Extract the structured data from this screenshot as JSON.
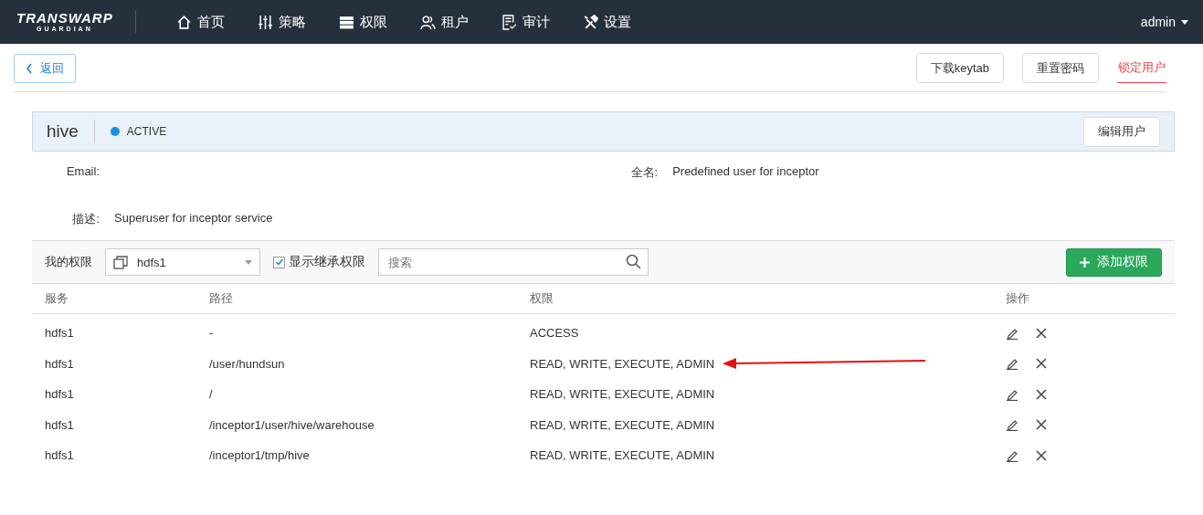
{
  "header": {
    "logo": {
      "title": "TRANSWARP",
      "subtitle": "GUARDIAN"
    },
    "nav": [
      {
        "label": "首页"
      },
      {
        "label": "策略"
      },
      {
        "label": "权限"
      },
      {
        "label": "租户"
      },
      {
        "label": "审计"
      },
      {
        "label": "设置"
      }
    ],
    "user_menu": "admin"
  },
  "toolbar": {
    "back": "返回",
    "actions": [
      {
        "label": "下载keytab",
        "kind": "button"
      },
      {
        "label": "重置密码",
        "kind": "button"
      },
      {
        "label": "锁定用户",
        "kind": "danger"
      }
    ]
  },
  "user": {
    "name": "hive",
    "status": "ACTIVE",
    "edit": "编辑用户",
    "fields": [
      {
        "label": "Email:"
      },
      {
        "label": "全名:",
        "value": "Predefined user for inceptor"
      },
      {
        "label": "描述:",
        "value": "Superuser for inceptor service"
      }
    ]
  },
  "filter": {
    "label": "我的权限",
    "service": "hdfs1",
    "inherit": {
      "label": "显示继承权限",
      "checked": true
    },
    "search": {
      "placeholder": "搜索"
    },
    "add": "添加权限"
  },
  "table": {
    "columns": [
      "服务",
      "路径",
      "权限",
      "操作"
    ],
    "rows": [
      {
        "service": "hdfs1",
        "path": "-",
        "permission": "ACCESS",
        "marked": false
      },
      {
        "service": "hdfs1",
        "path": "/user/hundsun",
        "permission": "READ, WRITE, EXECUTE, ADMIN",
        "marked": true
      },
      {
        "service": "hdfs1",
        "path": "/",
        "permission": "READ, WRITE, EXECUTE, ADMIN",
        "marked": false
      },
      {
        "service": "hdfs1",
        "path": "/inceptor1/user/hive/warehouse",
        "permission": "READ, WRITE, EXECUTE, ADMIN",
        "marked": false
      },
      {
        "service": "hdfs1",
        "path": "/inceptor1/tmp/hive",
        "permission": "READ, WRITE, EXECUTE, ADMIN",
        "marked": false
      }
    ]
  }
}
